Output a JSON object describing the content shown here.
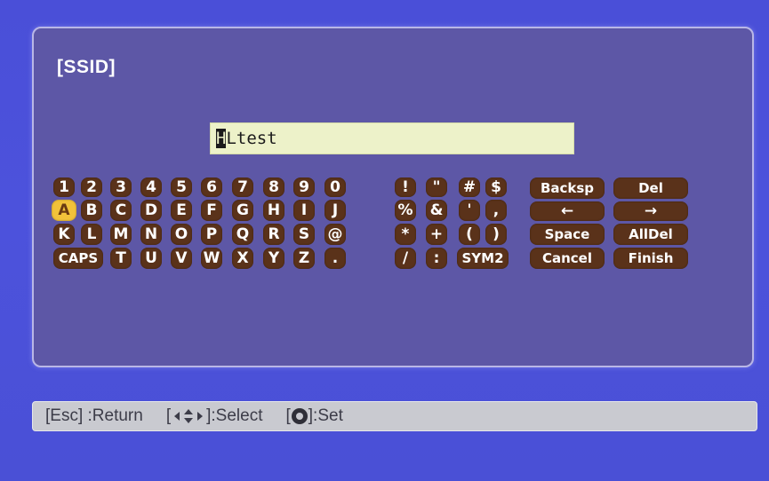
{
  "dialog": {
    "title": "[SSID]",
    "input": {
      "cursor_char": "H",
      "rest": "Ltest"
    }
  },
  "keyboard": {
    "keys": [
      "1",
      "2",
      "3",
      "4",
      "5",
      "6",
      "7",
      "8",
      "9",
      "0",
      "A",
      "B",
      "C",
      "D",
      "E",
      "F",
      "G",
      "H",
      "I",
      "J",
      "K",
      "L",
      "M",
      "N",
      "O",
      "P",
      "Q",
      "R",
      "S",
      "@",
      "CAPS",
      "T",
      "U",
      "V",
      "W",
      "X",
      "Y",
      "Z",
      ".",
      "!",
      "\"",
      "#",
      "$",
      "%",
      "&",
      "'",
      ",",
      "*",
      "+",
      "(",
      ")",
      "/",
      ":",
      "SYM2",
      "Backsp",
      "Del",
      "←",
      "→",
      "Space",
      "AllDel",
      "Cancel",
      "Finish"
    ],
    "selected_key": "A"
  },
  "help": {
    "esc_key": "[Esc]",
    "esc_action": ":Return",
    "select_open": "[",
    "select_close": "]:Select",
    "set_open": "[",
    "set_close": "]:Set",
    "icons": {
      "select": "arrow-keys-icon",
      "set": "enter-button-icon"
    }
  },
  "colors": {
    "background": "#4a4fd8",
    "dialog": "#5d57a6",
    "key": "#5a321a",
    "selected_key": "#f2c23a",
    "input_bg": "#edf2c9",
    "help_bar": "#c9cad0"
  }
}
